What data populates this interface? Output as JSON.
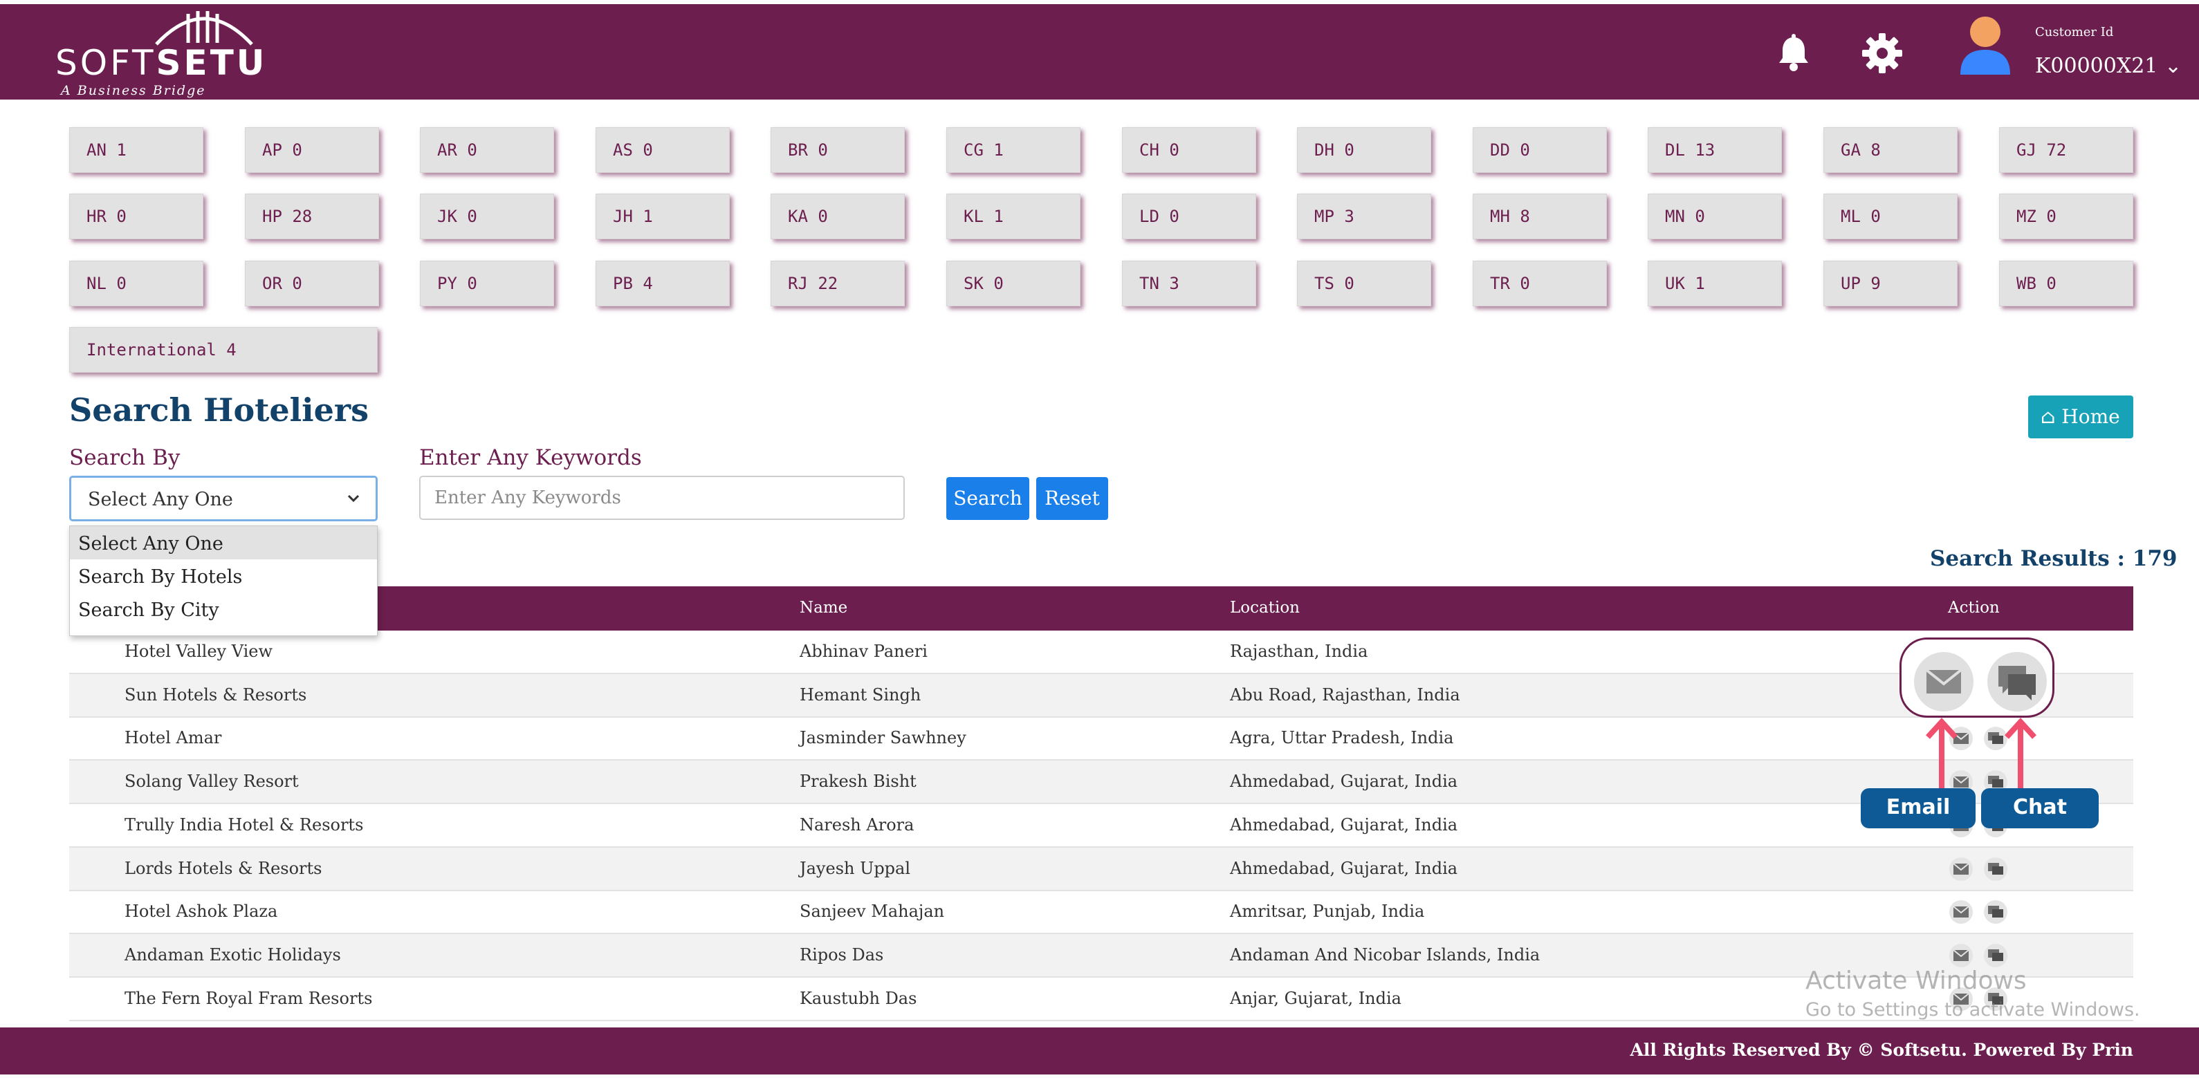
{
  "brand": {
    "soft": "SOFT",
    "setu": "SETU",
    "tagline": "A Business Bridge"
  },
  "header": {
    "customer_label": "Customer Id",
    "customer_id": "K00000X21"
  },
  "states": [
    {
      "code": "AN",
      "count": "1"
    },
    {
      "code": "AP",
      "count": "0"
    },
    {
      "code": "AR",
      "count": "0"
    },
    {
      "code": "AS",
      "count": "0"
    },
    {
      "code": "BR",
      "count": "0"
    },
    {
      "code": "CG",
      "count": "1"
    },
    {
      "code": "CH",
      "count": "0"
    },
    {
      "code": "DH",
      "count": "0"
    },
    {
      "code": "DD",
      "count": "0"
    },
    {
      "code": "DL",
      "count": "13"
    },
    {
      "code": "GA",
      "count": "8"
    },
    {
      "code": "GJ",
      "count": "72"
    },
    {
      "code": "HR",
      "count": "0"
    },
    {
      "code": "HP",
      "count": "28"
    },
    {
      "code": "JK",
      "count": "0"
    },
    {
      "code": "JH",
      "count": "1"
    },
    {
      "code": "KA",
      "count": "0"
    },
    {
      "code": "KL",
      "count": "1"
    },
    {
      "code": "LD",
      "count": "0"
    },
    {
      "code": "MP",
      "count": "3"
    },
    {
      "code": "MH",
      "count": "8"
    },
    {
      "code": "MN",
      "count": "0"
    },
    {
      "code": "ML",
      "count": "0"
    },
    {
      "code": "MZ",
      "count": "0"
    },
    {
      "code": "NL",
      "count": "0"
    },
    {
      "code": "OR",
      "count": "0"
    },
    {
      "code": "PY",
      "count": "0"
    },
    {
      "code": "PB",
      "count": "4"
    },
    {
      "code": "RJ",
      "count": "22"
    },
    {
      "code": "SK",
      "count": "0"
    },
    {
      "code": "TN",
      "count": "3"
    },
    {
      "code": "TS",
      "count": "0"
    },
    {
      "code": "TR",
      "count": "0"
    },
    {
      "code": "UK",
      "count": "1"
    },
    {
      "code": "UP",
      "count": "9"
    },
    {
      "code": "WB",
      "count": "0"
    },
    {
      "code": "International",
      "count": "4"
    }
  ],
  "search": {
    "title": "Search Hoteliers",
    "home_label": "Home",
    "search_by_label": "Search By",
    "selected": "Select Any One",
    "keywords_label": "Enter Any Keywords",
    "keywords_placeholder": "Enter Any Keywords",
    "keywords_value": "",
    "search_button": "Search",
    "reset_button": "Reset",
    "options": [
      "Select Any One",
      "Search By Hotels",
      "Search By City"
    ],
    "results_text": "Search Results : 179"
  },
  "table": {
    "columns": [
      "Name",
      "Location",
      "Action"
    ],
    "rows": [
      {
        "hotel": "Hotel Valley View",
        "name": "Abhinav Paneri",
        "location": "Rajasthan, India"
      },
      {
        "hotel": "Sun Hotels & Resorts",
        "name": "Hemant Singh",
        "location": "Abu Road, Rajasthan, India"
      },
      {
        "hotel": "Hotel Amar",
        "name": "Jasminder Sawhney",
        "location": "Agra, Uttar Pradesh, India"
      },
      {
        "hotel": "Solang Valley Resort",
        "name": "Prakesh Bisht",
        "location": "Ahmedabad, Gujarat, India"
      },
      {
        "hotel": "Trully India Hotel & Resorts",
        "name": "Naresh Arora",
        "location": "Ahmedabad, Gujarat, India"
      },
      {
        "hotel": "Lords Hotels & Resorts",
        "name": "Jayesh Uppal",
        "location": "Ahmedabad, Gujarat, India"
      },
      {
        "hotel": "Hotel Ashok Plaza",
        "name": "Sanjeev Mahajan",
        "location": "Amritsar, Punjab, India"
      },
      {
        "hotel": "Andaman Exotic Holidays",
        "name": "Ripos Das",
        "location": "Andaman And Nicobar Islands, India"
      },
      {
        "hotel": "The Fern Royal Fram Resorts",
        "name": "Kaustubh Das",
        "location": "Anjar, Gujarat, India"
      }
    ]
  },
  "callouts": {
    "email": "Email",
    "chat": "Chat"
  },
  "watermark": {
    "line1": "Activate Windows",
    "line2": "Go to Settings to activate Windows."
  },
  "footer": {
    "text": "All Rights Reserved By © Softsetu. Powered By Prin"
  },
  "colors": {
    "brand": "#6c1f4f",
    "title": "#12416a",
    "button": "#1a7fe8",
    "home": "#17a2b8",
    "callout": "#0d5a96",
    "arrow": "#f0506e"
  }
}
